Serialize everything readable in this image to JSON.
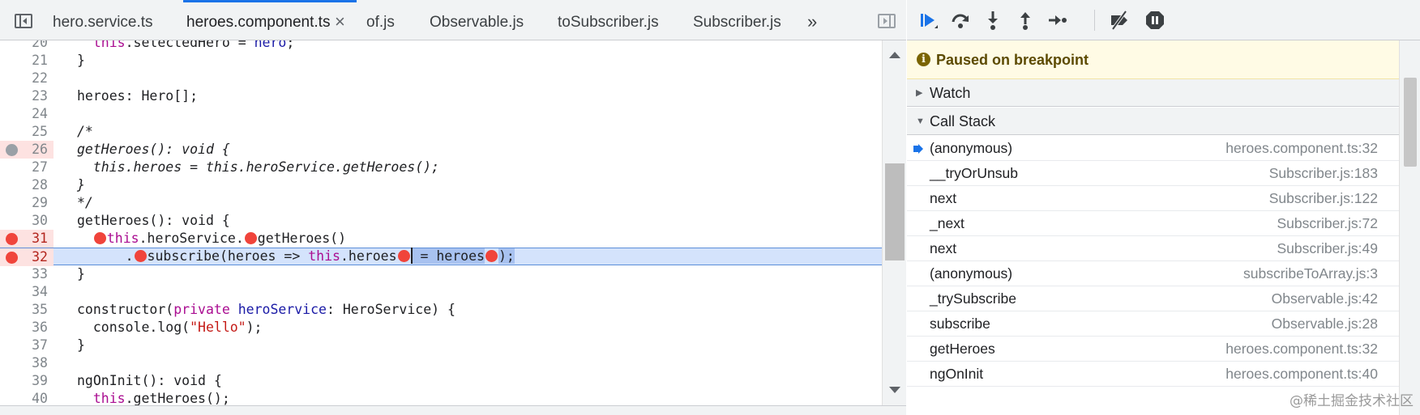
{
  "tabs": {
    "items": [
      "hero.service.ts",
      "heroes.component.ts",
      "of.js",
      "Observable.js",
      "toSubscriber.js",
      "Subscriber.js"
    ],
    "active": "heroes.component.ts",
    "close_glyph": "×",
    "more_glyph": "»"
  },
  "editor": {
    "lines": [
      {
        "n": "20",
        "code": "  this.selectedHero = hero;"
      },
      {
        "n": "21",
        "code": "}"
      },
      {
        "n": "22",
        "code": ""
      },
      {
        "n": "23",
        "code": "heroes: Hero[];"
      },
      {
        "n": "24",
        "code": ""
      },
      {
        "n": "25",
        "code": "/*"
      },
      {
        "n": "26",
        "code": "getHeroes(): void {"
      },
      {
        "n": "27",
        "code": "  this.heroes = this.heroService.getHeroes();"
      },
      {
        "n": "28",
        "code": "}"
      },
      {
        "n": "29",
        "code": "*/"
      },
      {
        "n": "30",
        "code": "getHeroes(): void {"
      },
      {
        "n": "31",
        "code": "this.heroService.getHeroes()"
      },
      {
        "n": "32",
        "code": ".subscribe(heroes => this.heroes = heroes);"
      },
      {
        "n": "33",
        "code": "}"
      },
      {
        "n": "34",
        "code": ""
      },
      {
        "n": "35",
        "code": "constructor(private heroService: HeroService) {"
      },
      {
        "n": "36",
        "code": "  console.log(\"Hello\");"
      },
      {
        "n": "37",
        "code": "}"
      },
      {
        "n": "38",
        "code": ""
      },
      {
        "n": "39",
        "code": "ngOnInit(): void {"
      },
      {
        "n": "40",
        "code": "  this.getHeroes();"
      }
    ],
    "line31": {
      "a": "this",
      "b": ".heroService.",
      "c": "getHeroes()"
    },
    "line32": {
      "a": ".",
      "b": "subscribe(heroes => ",
      "c": "this",
      "d": ".heroes",
      "e": " = heroes",
      "f": ");"
    },
    "line35": {
      "a": "constructor(",
      "b": "private",
      "c": " ",
      "d": "heroService",
      "e": ": HeroService) {"
    },
    "line36": {
      "a": "  console.log(",
      "b": "\"Hello\"",
      "c": ");"
    },
    "line40": {
      "a": "  ",
      "b": "this",
      "c": ".getHeroes();"
    },
    "line20": {
      "a": "  ",
      "b": "this",
      "c": ".selectedHero = ",
      "d": "hero",
      "e": ";"
    },
    "line27": {
      "a": "  this.heroes = this.heroService.getHeroes();"
    }
  },
  "debugger": {
    "toolbar_icons": [
      "resume-icon",
      "step-over-icon",
      "step-into-icon",
      "step-out-icon",
      "step-icon",
      "deactivate-breakpoints-icon",
      "pause-on-exceptions-icon"
    ],
    "paused_message": "Paused on breakpoint",
    "sections": {
      "watch": "Watch",
      "call_stack": "Call Stack"
    },
    "call_stack": [
      {
        "fn": "(anonymous)",
        "loc": "heroes.component.ts:32",
        "current": true
      },
      {
        "fn": "__tryOrUnsub",
        "loc": "Subscriber.js:183"
      },
      {
        "fn": "next",
        "loc": "Subscriber.js:122"
      },
      {
        "fn": "_next",
        "loc": "Subscriber.js:72"
      },
      {
        "fn": "next",
        "loc": "Subscriber.js:49"
      },
      {
        "fn": "(anonymous)",
        "loc": "subscribeToArray.js:3"
      },
      {
        "fn": "_trySubscribe",
        "loc": "Observable.js:42"
      },
      {
        "fn": "subscribe",
        "loc": "Observable.js:28"
      },
      {
        "fn": "getHeroes",
        "loc": "heroes.component.ts:32"
      },
      {
        "fn": "ngOnInit",
        "loc": "heroes.component.ts:40"
      }
    ]
  },
  "colors": {
    "accent": "#1a73e8",
    "breakpoint": "#f0443b",
    "exec_line": "#d4e3fc",
    "paused_bg": "#fffbe5"
  },
  "watermark": "@稀土掘金技术社区"
}
